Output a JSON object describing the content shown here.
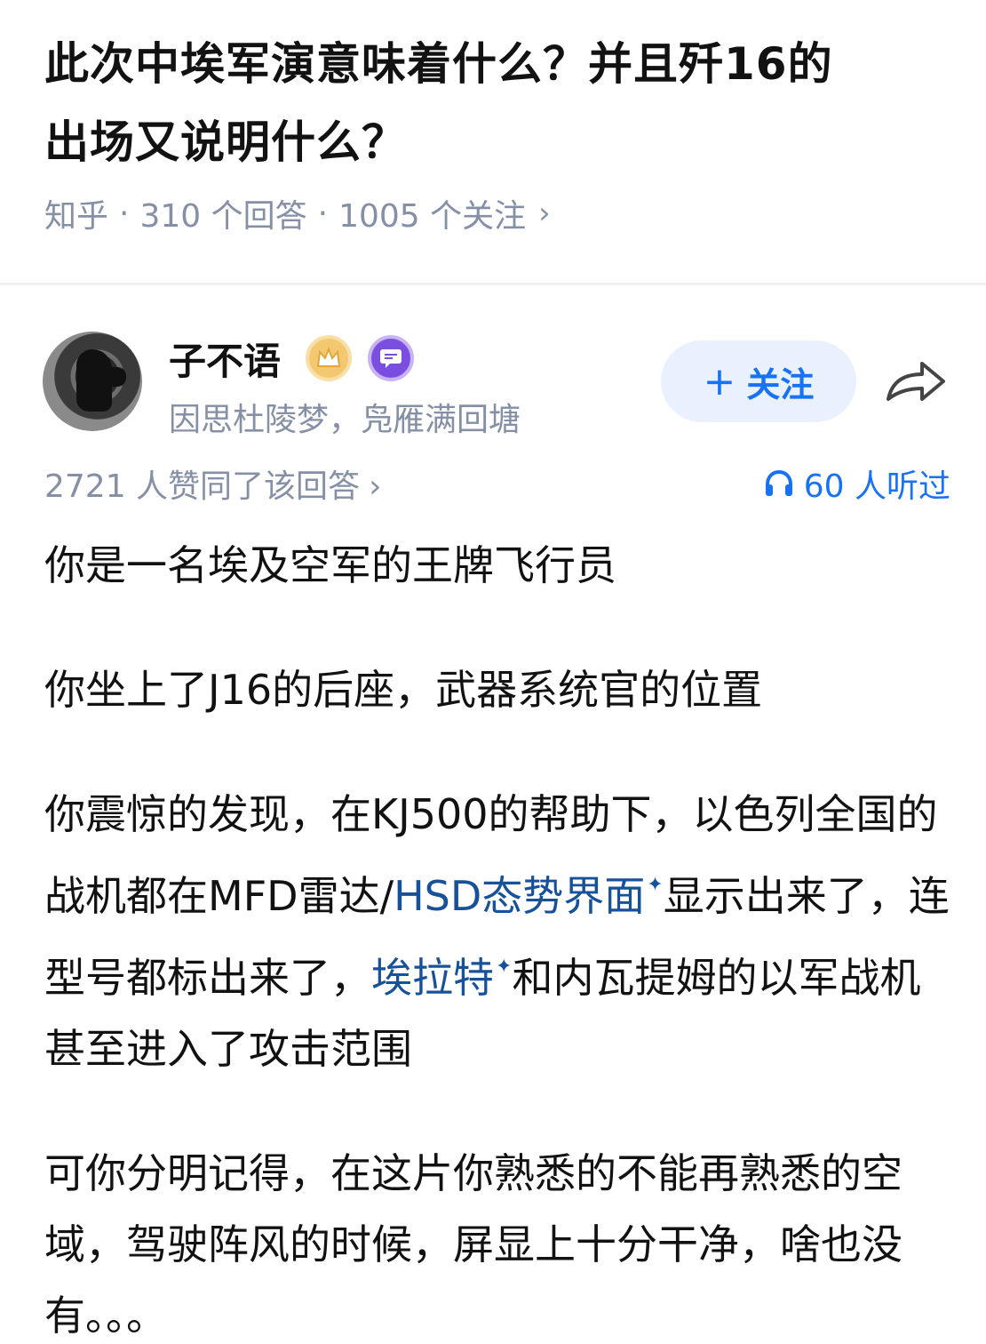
{
  "question": {
    "title_line1": "此次中埃军演意味着什么？并且歼16的",
    "title_line2": "出场又说明什么？",
    "source": "知乎",
    "answers": "310 个回答",
    "followers": "1005 个关注",
    "chevron": "›"
  },
  "author": {
    "name": "子不语",
    "bio": "因思杜陵梦，凫雁满回塘",
    "follow_label": "关注",
    "follow_plus": "+"
  },
  "stats": {
    "agree": "2721 人赞同了该回答",
    "agree_chevron": "›",
    "listened": "60 人听过"
  },
  "content": {
    "p1": "你是一名埃及空军的王牌飞行员",
    "p2": "你坐上了J16的后座，武器系统官的位置",
    "p3_a": "你震惊的发现，在KJ500的帮助下，以色列全国的战机都在MFD雷达/",
    "p3_link1": "HSD态势界面",
    "p3_b": "显示出来了，连型号都标出来了，",
    "p3_link2": "埃拉特",
    "p3_c": "和内瓦提姆的以军战机甚至进入了攻击范围",
    "p4": "可你分明记得，在这片你熟悉的不能再熟悉的空域，驾驶阵风的时候，屏显上十分干净，啥也没有。。。",
    "spark": "✦"
  },
  "colors": {
    "accent": "#1772f6",
    "link": "#175199",
    "meta": "#8590a6"
  }
}
